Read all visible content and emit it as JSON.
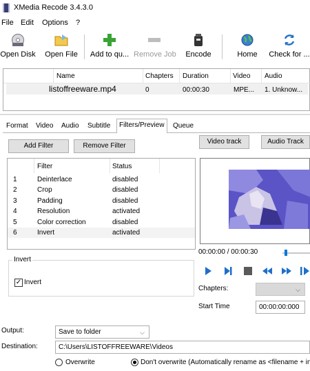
{
  "window": {
    "title": "XMedia Recode 3.4.3.0"
  },
  "menu": [
    "File",
    "Edit",
    "Options",
    "?"
  ],
  "toolbar": {
    "open_disk": "Open Disk",
    "open_file": "Open File",
    "add_to_queue": "Add to qu...",
    "remove_job": "Remove Job",
    "encode": "Encode",
    "home": "Home",
    "check_for": "Check for ..."
  },
  "file_list": {
    "columns": [
      "Name",
      "Chapters",
      "Duration",
      "Video",
      "Audio"
    ],
    "rows": [
      {
        "name": "listoffreeware.mp4",
        "chapters": "0",
        "duration": "00:00:30",
        "video": "MPE...",
        "audio": "1. Unknow..."
      }
    ]
  },
  "tabs": [
    "Format",
    "Video",
    "Audio",
    "Subtitle",
    "Filters/Preview",
    "Queue"
  ],
  "active_tab": "Filters/Preview",
  "filters_panel": {
    "add_filter": "Add Filter",
    "remove_filter": "Remove Filter",
    "video_track": "Video track",
    "audio_track": "Audio Track",
    "columns": [
      "Filter",
      "Status"
    ],
    "rows": [
      {
        "num": "1",
        "filter": "Deinterlace",
        "status": "disabled"
      },
      {
        "num": "2",
        "filter": "Crop",
        "status": "disabled"
      },
      {
        "num": "3",
        "filter": "Padding",
        "status": "disabled"
      },
      {
        "num": "4",
        "filter": "Resolution",
        "status": "activated"
      },
      {
        "num": "5",
        "filter": "Color correction",
        "status": "disabled"
      },
      {
        "num": "6",
        "filter": "Invert",
        "status": "activated"
      }
    ],
    "group_title": "Invert",
    "invert_label": "Invert",
    "invert_checked": true
  },
  "preview": {
    "time": "00:00:00 / 00:00:30",
    "chapters_label": "Chapters:",
    "start_time_label": "Start Time",
    "start_time_value": "00:00:00:000"
  },
  "output": {
    "output_label": "Output:",
    "output_value": "Save to folder",
    "destination_label": "Destination:",
    "destination_value": "C:\\Users\\LISTOFFREEWARE\\Videos",
    "overwrite": "Overwrite",
    "dont_overwrite": "Don't overwrite (Automatically rename as <filename + in"
  },
  "colors": {
    "accent": "#0078d7",
    "play_controls": "#1e6fc9",
    "video_bg": "#5a54c6"
  }
}
